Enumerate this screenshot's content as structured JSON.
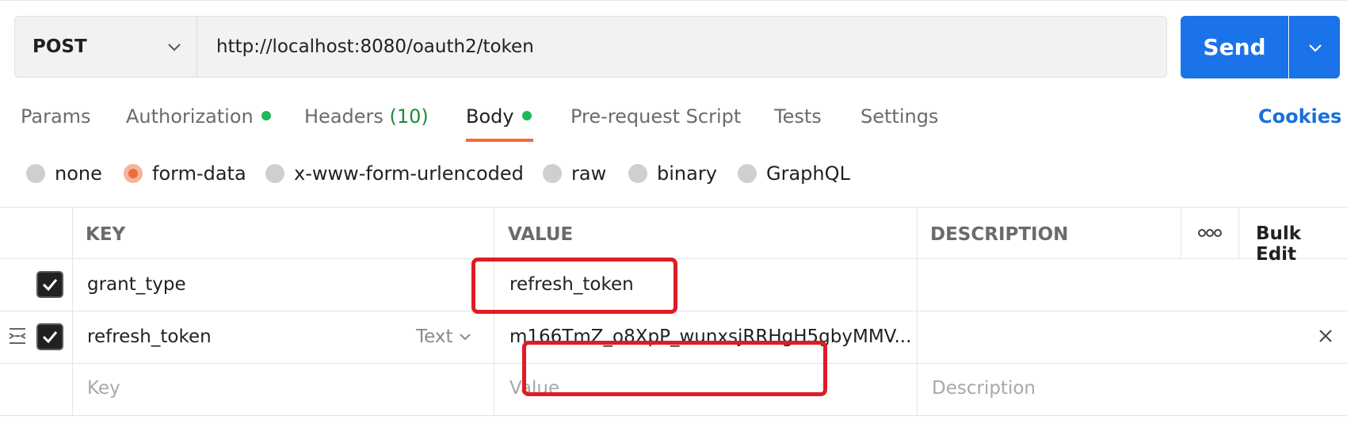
{
  "request": {
    "method": "POST",
    "url": "http://localhost:8080/oauth2/token",
    "send_label": "Send"
  },
  "tabs": [
    {
      "label": "Params"
    },
    {
      "label": "Authorization",
      "indicator": true
    },
    {
      "label": "Headers",
      "count": "(10)"
    },
    {
      "label": "Body",
      "indicator": true,
      "active": true
    },
    {
      "label": "Pre-request Script"
    },
    {
      "label": "Tests"
    },
    {
      "label": "Settings"
    }
  ],
  "cookies_label": "Cookies",
  "body_types": [
    {
      "label": "none"
    },
    {
      "label": "form-data",
      "selected": true
    },
    {
      "label": "x-www-form-urlencoded"
    },
    {
      "label": "raw"
    },
    {
      "label": "binary"
    },
    {
      "label": "GraphQL"
    }
  ],
  "table": {
    "headers": {
      "key": "KEY",
      "value": "VALUE",
      "description": "DESCRIPTION",
      "bulk_edit": "Bulk Edit"
    },
    "rows": [
      {
        "checked": true,
        "key": "grant_type",
        "value": "refresh_token",
        "description": ""
      },
      {
        "checked": true,
        "key": "refresh_token",
        "type": "Text",
        "value": "m166TmZ_o8XpP_wunxsjRRHgH5gbyMMV...",
        "description": ""
      }
    ],
    "placeholders": {
      "key": "Key",
      "value": "Value",
      "description": "Description"
    }
  },
  "colors": {
    "accent_blue": "#1a73e8",
    "active_tab_orange": "#f26b3a",
    "indicator_green": "#1fb85a",
    "annotation_red": "#e01b24"
  }
}
